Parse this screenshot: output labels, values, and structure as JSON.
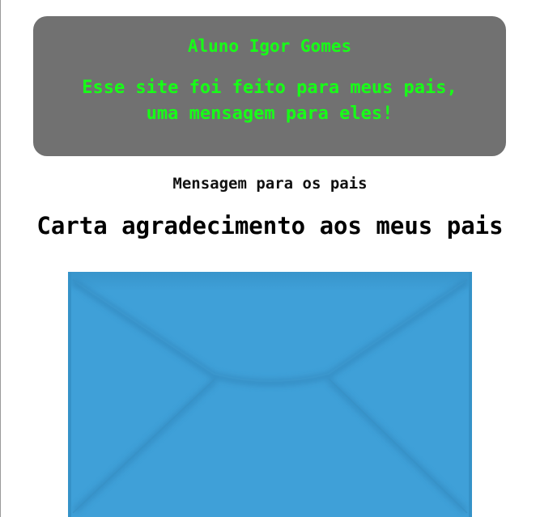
{
  "header": {
    "author": "Aluno Igor Gomes",
    "tagline_line1": "Esse site foi feito para meus pais,",
    "tagline_line2": "uma mensagem para eles!"
  },
  "main": {
    "subtitle": "Mensagem para os pais",
    "title": "Carta agradecimento aos meus pais"
  },
  "envelope": {
    "icon": "envelope-icon",
    "color": "#3fa0d8"
  },
  "colors": {
    "header_bg": "#717171",
    "header_text": "#17ff17",
    "page_bg": "#ffffff"
  }
}
